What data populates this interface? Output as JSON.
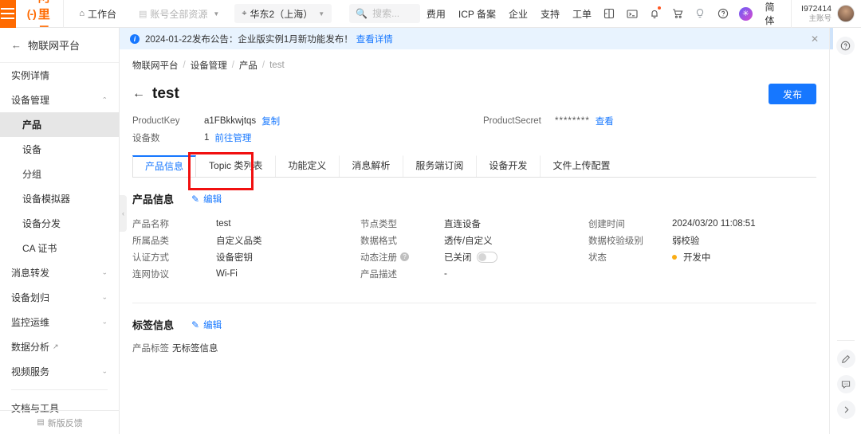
{
  "header": {
    "logo_text": "阿里云",
    "logo_mark": "(-)",
    "workbench": "工作台",
    "resources": "账号全部资源",
    "region": "华东2（上海）",
    "search_placeholder": "搜索...",
    "links": [
      "费用",
      "ICP 备案",
      "企业",
      "支持",
      "工单"
    ],
    "icons": [
      "app-switch-icon",
      "console-terminal-icon",
      "bell-icon",
      "cart-icon",
      "bulb-icon",
      "help-circle-icon",
      "ai-assistant-icon"
    ],
    "lang": "简体",
    "account_id": "I972414",
    "account_type": "主账号"
  },
  "sidebar": {
    "title": "物联网平台",
    "items": [
      {
        "label": "实例详情",
        "type": "item"
      },
      {
        "label": "设备管理",
        "type": "group",
        "expanded": true
      },
      {
        "label": "产品",
        "type": "sub",
        "active": true
      },
      {
        "label": "设备",
        "type": "sub"
      },
      {
        "label": "分组",
        "type": "sub"
      },
      {
        "label": "设备模拟器",
        "type": "sub"
      },
      {
        "label": "设备分发",
        "type": "sub"
      },
      {
        "label": "CA 证书",
        "type": "sub"
      },
      {
        "label": "消息转发",
        "type": "group"
      },
      {
        "label": "设备划归",
        "type": "group"
      },
      {
        "label": "监控运维",
        "type": "group"
      },
      {
        "label": "数据分析",
        "type": "external"
      },
      {
        "label": "视频服务",
        "type": "group"
      },
      {
        "label": "文档与工具",
        "type": "item"
      }
    ],
    "footer": "新版反馈"
  },
  "notice": {
    "text": "2024-01-22发布公告：企业版实例1月新功能发布！",
    "link": "查看详情"
  },
  "breadcrumb": [
    "物联网平台",
    "设备管理",
    "产品",
    "test"
  ],
  "page": {
    "title": "test",
    "publish_button": "发布"
  },
  "meta": {
    "product_key_label": "ProductKey",
    "product_key_value": "a1FBkkwjtqs",
    "copy_link": "复制",
    "device_count_label": "设备数",
    "device_count_value": "1",
    "device_manage_link": "前往管理",
    "product_secret_label": "ProductSecret",
    "product_secret_value": "********",
    "view_link": "查看"
  },
  "tabs": [
    {
      "label": "产品信息",
      "active": true
    },
    {
      "label": "Topic 类列表",
      "highlighted": true
    },
    {
      "label": "功能定义"
    },
    {
      "label": "消息解析"
    },
    {
      "label": "服务端订阅"
    },
    {
      "label": "设备开发"
    },
    {
      "label": "文件上传配置"
    }
  ],
  "product_info": {
    "section_title": "产品信息",
    "edit_label": "编辑",
    "col1": [
      {
        "label": "产品名称",
        "value": "test"
      },
      {
        "label": "所属品类",
        "value": "自定义品类"
      },
      {
        "label": "认证方式",
        "value": "设备密钥"
      },
      {
        "label": "连网协议",
        "value": "Wi-Fi"
      }
    ],
    "col2": [
      {
        "label": "节点类型",
        "value": "直连设备"
      },
      {
        "label": "数据格式",
        "value": "透传/自定义"
      },
      {
        "label": "动态注册",
        "value": "已关闭",
        "has_help": true,
        "has_toggle": true
      },
      {
        "label": "产品描述",
        "value": "-"
      }
    ],
    "col3": [
      {
        "label": "创建时间",
        "value": "2024/03/20 11:08:51"
      },
      {
        "label": "数据校验级别",
        "value": "弱校验"
      },
      {
        "label": "状态",
        "value": "开发中",
        "has_dot": true
      }
    ]
  },
  "tag_info": {
    "section_title": "标签信息",
    "edit_label": "编辑",
    "label": "产品标签",
    "value": "无标签信息"
  },
  "rail": {
    "icons": [
      "help-circle-icon",
      "feedback-pen-icon",
      "chat-icon",
      "expand-chevron-icon"
    ]
  },
  "colors": {
    "brand_orange": "#ff6a00",
    "primary_blue": "#1677ff",
    "highlight_red": "#f11010",
    "status_orange": "#faad14"
  }
}
